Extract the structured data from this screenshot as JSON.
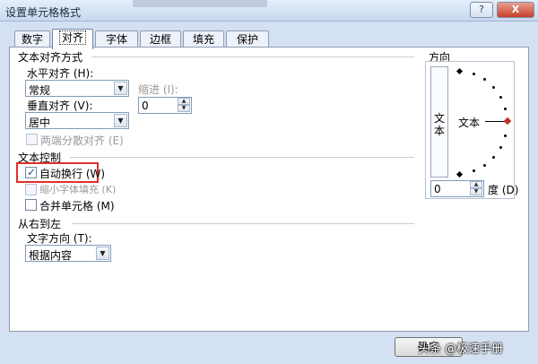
{
  "window": {
    "title": "设置单元格格式",
    "help_label": "?",
    "close_label": "X"
  },
  "tabs": [
    {
      "label": "数字",
      "active": false
    },
    {
      "label": "对齐",
      "active": true
    },
    {
      "label": "字体",
      "active": false
    },
    {
      "label": "边框",
      "active": false
    },
    {
      "label": "填充",
      "active": false
    },
    {
      "label": "保护",
      "active": false
    }
  ],
  "alignment": {
    "section_label": "文本对齐方式",
    "horizontal_label": "水平对齐 (H):",
    "horizontal_value": "常规",
    "indent_label": "缩进 (I):",
    "indent_value": "0",
    "vertical_label": "垂直对齐 (V):",
    "vertical_value": "居中",
    "justify_distributed_label": "两端分散对齐 (E)"
  },
  "text_control": {
    "section_label": "文本控制",
    "wrap_text_label": "自动换行 (W)",
    "wrap_text_checked": true,
    "shrink_to_fit_label": "缩小字体填充 (K)",
    "shrink_to_fit_checked": false,
    "merge_cells_label": "合并单元格 (M)",
    "merge_cells_checked": false
  },
  "rtl": {
    "section_label": "从右到左",
    "direction_label": "文字方向 (T):",
    "direction_value": "根据内容"
  },
  "orientation": {
    "section_label": "方向",
    "vertical_text": "文本",
    "horizontal_text": "文本",
    "degrees_value": "0",
    "degrees_label": "度 (D)"
  },
  "footer": {
    "ok_label": "确定",
    "watermark": "头条 @极速手册"
  },
  "colors": {
    "highlight_border": "#e0302b",
    "orientation_marker": "#c0302a"
  }
}
